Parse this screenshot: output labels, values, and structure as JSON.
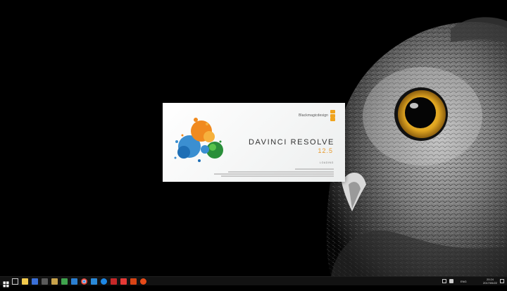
{
  "splash": {
    "brand": "Blackmagicdesign",
    "title": "DAVINCI RESOLVE",
    "version": "12.5",
    "status": "LOADING"
  },
  "taskbar": {
    "icons": [
      "windows-start-icon",
      "task-view-icon",
      "file-explorer-icon",
      "store-icon",
      "app-icon",
      "folder-icon",
      "media-player-icon",
      "photos-icon",
      "chrome-icon",
      "check-icon",
      "edge-icon",
      "red-app-icon",
      "vivaldi-icon",
      "media-app-icon",
      "red-circle-icon"
    ],
    "language": "ENG",
    "time": "20:24",
    "date": "2017/05/22"
  },
  "colors": {
    "accent": "#e69a2e",
    "taskbar": "#121212",
    "desktop": "#000000"
  }
}
